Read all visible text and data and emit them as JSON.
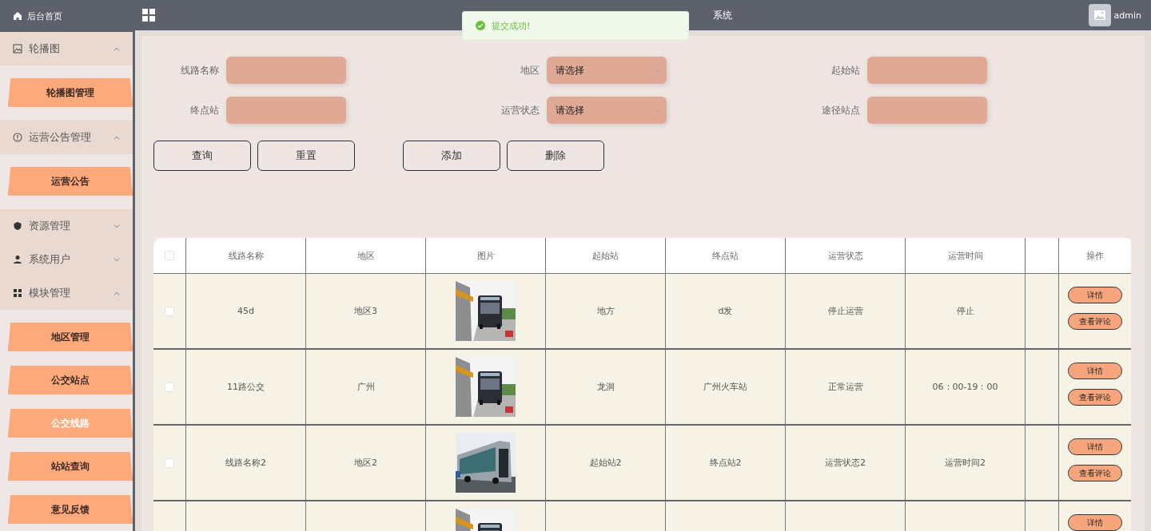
{
  "header": {
    "title": "系统",
    "user": "admin"
  },
  "toast": {
    "message": "提交成功!"
  },
  "sidebar": {
    "home": "后台首页",
    "groups": [
      {
        "label": "轮播图",
        "expanded": true,
        "children": [
          {
            "label": "轮播图管理",
            "selected": false
          }
        ]
      },
      {
        "label": "运营公告管理",
        "expanded": true,
        "children": [
          {
            "label": "运营公告",
            "selected": false
          }
        ]
      },
      {
        "label": "资源管理",
        "expanded": false
      },
      {
        "label": "系统用户",
        "expanded": false
      },
      {
        "label": "模块管理",
        "expanded": true,
        "children": [
          {
            "label": "地区管理",
            "selected": false
          },
          {
            "label": "公交站点",
            "selected": false
          },
          {
            "label": "公交线路",
            "selected": true
          },
          {
            "label": "站站查询",
            "selected": false
          },
          {
            "label": "意见反馈",
            "selected": false
          }
        ]
      }
    ]
  },
  "form": {
    "fields": [
      {
        "label": "线路名称",
        "kind": "input"
      },
      {
        "label": "地区",
        "kind": "select",
        "placeholder": "请选择"
      },
      {
        "label": "起始站",
        "kind": "input"
      },
      {
        "label": "终点站",
        "kind": "input"
      },
      {
        "label": "运营状态",
        "kind": "select",
        "placeholder": "请选择"
      },
      {
        "label": "途径站点",
        "kind": "input"
      }
    ],
    "button_groups": [
      [
        "查询",
        "重置"
      ],
      [
        "添加",
        "删除"
      ]
    ]
  },
  "table": {
    "header_checked": false,
    "columns": [
      "线路名称",
      "地区",
      "图片",
      "起始站",
      "终点站",
      "运营状态",
      "运营时间"
    ],
    "actions_header": "操作",
    "rows": [
      {
        "checked": false,
        "name": "45d",
        "region": "地区3",
        "start": "地方",
        "end": "d发",
        "status": "停止运营",
        "time": "停止",
        "actions": [
          "详情",
          "查看评论"
        ]
      },
      {
        "checked": false,
        "name": "11路公交",
        "region": "广州",
        "start": "龙洞",
        "end": "广州火车站",
        "status": "正常运营",
        "time": "06：00-19：00",
        "actions": [
          "详情",
          "查看评论"
        ]
      },
      {
        "checked": false,
        "name": "线路名称2",
        "region": "地区2",
        "start": "起始站2",
        "end": "终点站2",
        "status": "运营状态2",
        "time": "运营时间2",
        "actions": [
          "详情",
          "查看评论"
        ]
      },
      {
        "actions": [
          "详情"
        ]
      }
    ]
  }
}
